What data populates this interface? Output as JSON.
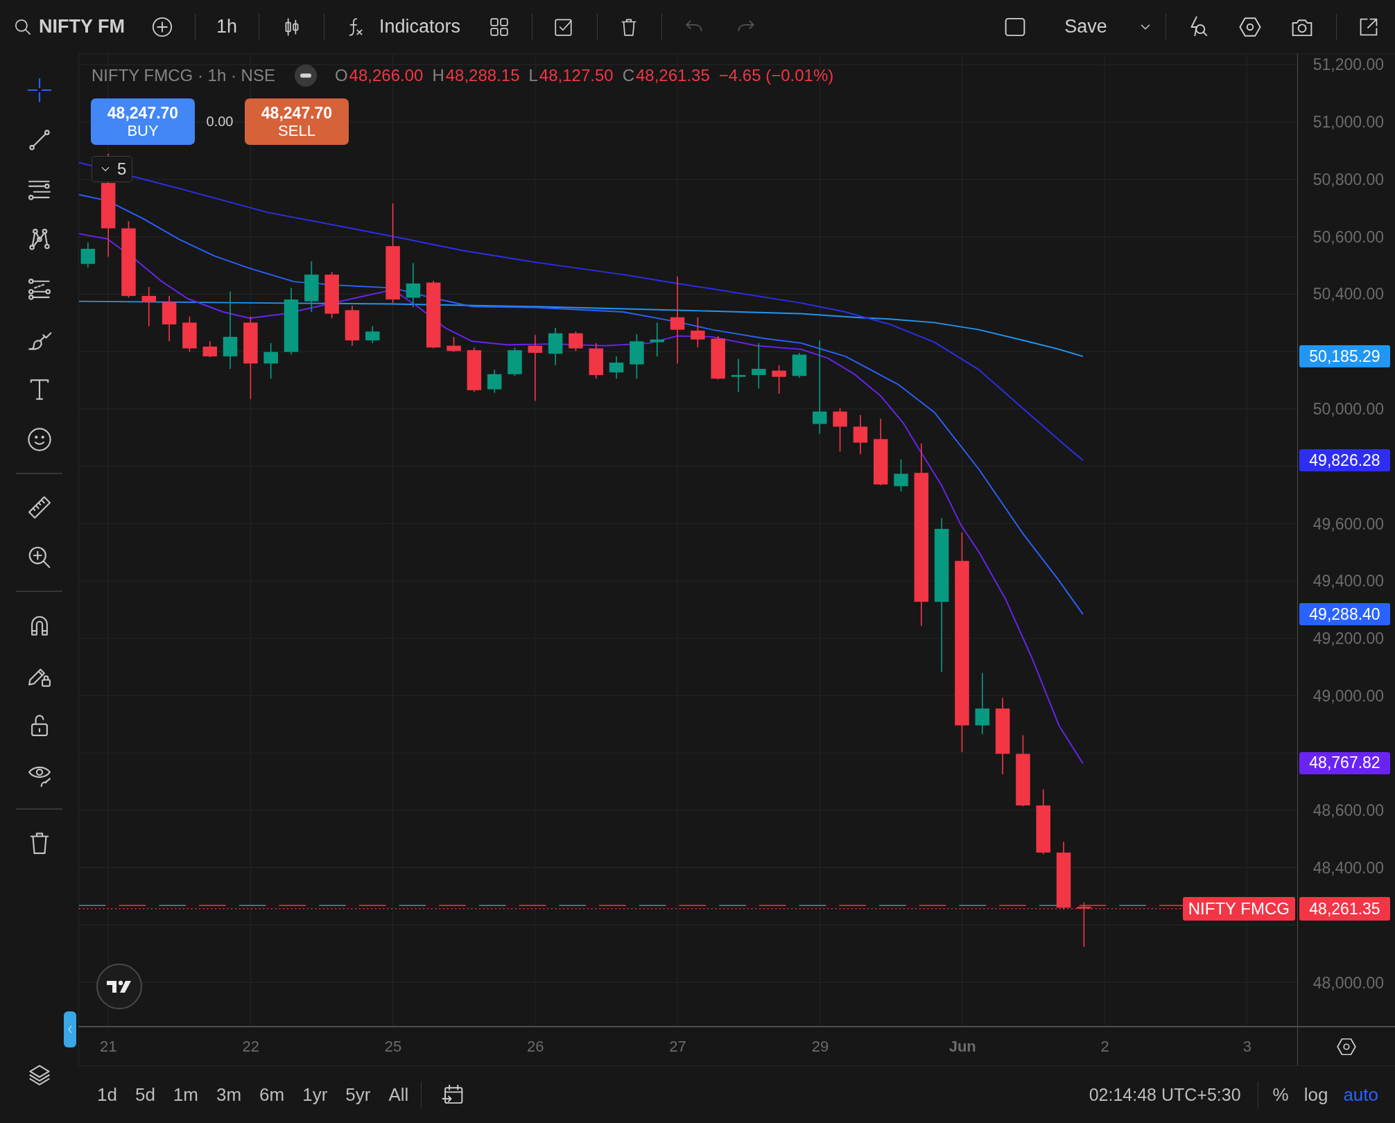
{
  "top_toolbar": {
    "symbol": "NIFTY FM",
    "interval": "1h",
    "indicators_label": "Indicators",
    "history_buttons": [
      {
        "disabled": true
      },
      {
        "disabled": true
      }
    ],
    "save_label": "Save"
  },
  "drawing_tools": [
    {
      "selected": true
    },
    {
      "selected": false
    },
    {
      "selected": false
    },
    {
      "selected": false
    },
    {
      "selected": false
    },
    {
      "selected": false
    },
    {
      "selected": false
    },
    {
      "selected": false
    },
    {
      "selected": false
    },
    {
      "selected": false
    },
    {
      "selected": false
    },
    {
      "selected": false
    },
    {
      "selected": false
    },
    {
      "selected": false
    },
    {
      "selected": false
    }
  ],
  "legend": {
    "title": "NIFTY FMCG · 1h · NSE",
    "ohlc": [
      {
        "label": "O",
        "value": "48,266.00"
      },
      {
        "label": "H",
        "value": "48,288.15"
      },
      {
        "label": "L",
        "value": "48,127.50"
      },
      {
        "label": "C",
        "value": "48,261.35"
      }
    ],
    "change": "−4.65 (−0.01%)",
    "buy": {
      "price": "48,247.70",
      "label": "BUY"
    },
    "spread": "0.00",
    "sell": {
      "price": "48,247.70",
      "label": "SELL"
    },
    "indicator_count": "5"
  },
  "indicators": [
    {
      "value": "50,185.29",
      "color": "#2196f3"
    },
    {
      "value": "49,826.28",
      "color": "#2e2ef2"
    },
    {
      "value": "49,288.40",
      "color": "#2962ff"
    },
    {
      "value": "48,767.82",
      "color": "#6a24f2"
    }
  ],
  "last_price": {
    "symbol": "NIFTY FMCG",
    "value": "48,261.35"
  },
  "price_scale": {
    "ticks": [
      "51,200.00",
      "51,000.00",
      "50,800.00",
      "50,600.00",
      "50,400.00",
      "50,000.00",
      "49,600.00",
      "49,400.00",
      "49,200.00",
      "49,000.00",
      "48,600.00",
      "48,400.00",
      "48,000.00"
    ]
  },
  "time_scale": {
    "labels": [
      {
        "label": "21",
        "kind": "day"
      },
      {
        "label": "22",
        "kind": "day"
      },
      {
        "label": "25",
        "kind": "day"
      },
      {
        "label": "26",
        "kind": "day"
      },
      {
        "label": "27",
        "kind": "day"
      },
      {
        "label": "29",
        "kind": "day"
      },
      {
        "label": "Jun",
        "kind": "month"
      },
      {
        "label": "2",
        "kind": "day"
      },
      {
        "label": "3",
        "kind": "day"
      }
    ]
  },
  "bottom_bar": {
    "ranges": [
      "1d",
      "5d",
      "1m",
      "3m",
      "6m",
      "1yr",
      "5yr",
      "All"
    ],
    "clock": "02:14:48 UTC+5:30",
    "scale_modes": [
      {
        "label": "%",
        "on": false
      },
      {
        "label": "log",
        "on": false
      },
      {
        "label": "auto",
        "on": true
      }
    ]
  }
}
